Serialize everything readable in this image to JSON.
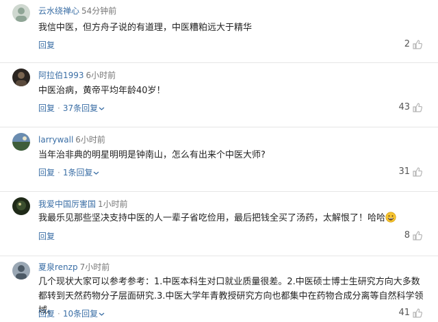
{
  "comments": [
    {
      "username": "云水绕禅心",
      "time": "54分钟前",
      "content": "我信中医，但方舟子说的有道理，中医糟粕远大于精华",
      "reply_label": "回复",
      "replies_label": "",
      "likes": "2",
      "avatar_colors": [
        "#cfd8d0",
        "#8fa596"
      ]
    },
    {
      "username": "阿拉伯1993",
      "time": "6小时前",
      "content": "中医治病，黄帝平均年龄40岁！",
      "reply_label": "回复",
      "replies_label": "37条回复",
      "likes": "43",
      "avatar_colors": [
        "#5a4a3c",
        "#2a2420"
      ]
    },
    {
      "username": "larrywall",
      "time": "6小时前",
      "content": "当年治非典的明星明明是钟南山，怎么有出来个中医大师?",
      "reply_label": "回复",
      "replies_label": "1条回复",
      "likes": "31",
      "avatar_colors": [
        "#6a8cb0",
        "#3e5d3a"
      ]
    },
    {
      "username": "我爱中国厉害国",
      "time": "1小时前",
      "content": "我最乐见那些坚决支持中医的人一辈子省吃俭用，最后把钱全买了汤药，太解恨了！哈哈",
      "reply_label": "回复",
      "replies_label": "",
      "likes": "8",
      "avatar_colors": [
        "#3b4f2e",
        "#1f2a18"
      ]
    },
    {
      "username": "夏泉renzp",
      "time": "7小时前",
      "content": "几个现状大家可以参考参考：1.中医本科生对口就业质量很差。2.中医硕士博士生研究方向大多数都转到天然药物分子层面研究.3.中医大学年青教授研究方向也都集中在药物合成分离等自然科学领域。",
      "reply_label": "回复",
      "replies_label": "10条回复",
      "likes": "41",
      "avatar_colors": [
        "#9aa7b4",
        "#4d5a66"
      ]
    }
  ],
  "colors": {
    "link": "#3a6ea5",
    "meta": "#777777",
    "divider": "#e6e6e6"
  },
  "icons": {
    "like": "thumbs-up-icon",
    "expand": "chevron-down-icon",
    "laugh": "grinning-emoji-icon"
  }
}
